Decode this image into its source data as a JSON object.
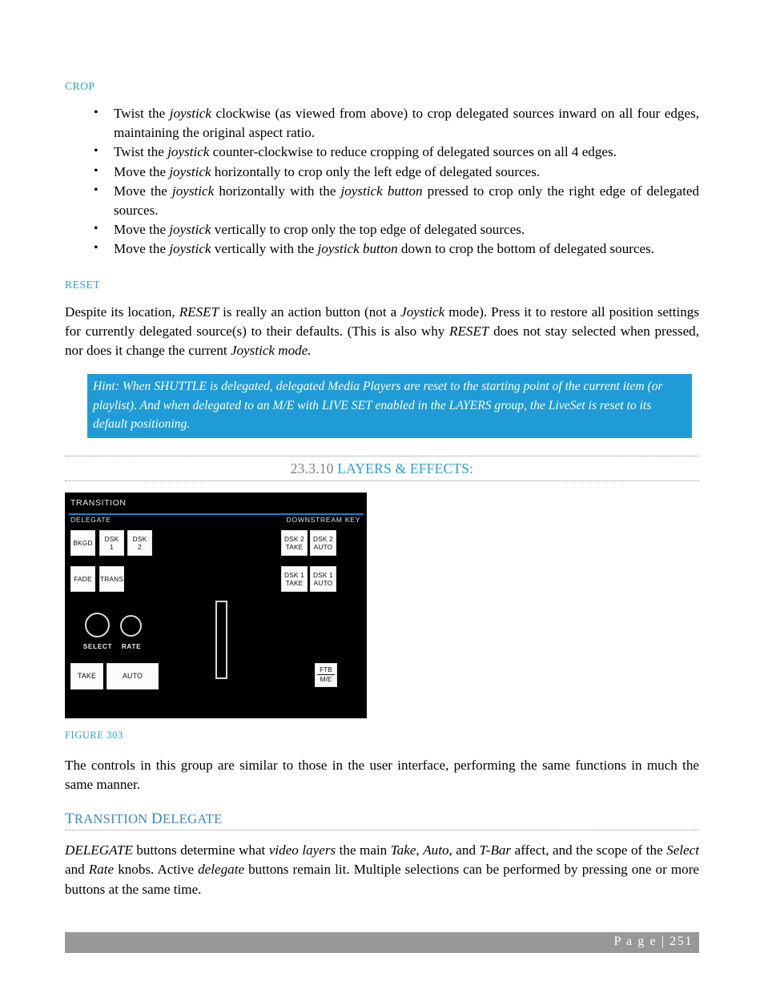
{
  "page": {
    "footer_label": "P a g e  | 251"
  },
  "crop_section": {
    "heading": "CROP",
    "bullets": [
      {
        "parts": [
          {
            "t": "Twist the ",
            "i": false
          },
          {
            "t": "joystick",
            "i": true
          },
          {
            "t": " clockwise (as viewed from above) to crop delegated sources inward on all four edges, maintaining the original aspect ratio.",
            "i": false
          }
        ]
      },
      {
        "parts": [
          {
            "t": "Twist the ",
            "i": false
          },
          {
            "t": "joystick",
            "i": true
          },
          {
            "t": " counter-clockwise to reduce cropping of delegated sources on all 4 edges.",
            "i": false
          }
        ]
      },
      {
        "parts": [
          {
            "t": "Move the ",
            "i": false
          },
          {
            "t": "joystick",
            "i": true
          },
          {
            "t": " horizontally to crop only the left edge of delegated sources.",
            "i": false
          }
        ]
      },
      {
        "parts": [
          {
            "t": "Move the ",
            "i": false
          },
          {
            "t": "joystick",
            "i": true
          },
          {
            "t": " horizontally with the ",
            "i": false
          },
          {
            "t": "joystick button",
            "i": true
          },
          {
            "t": " pressed to crop only the right edge of delegated sources.",
            "i": false
          }
        ]
      },
      {
        "parts": [
          {
            "t": "Move the ",
            "i": false
          },
          {
            "t": "joystick",
            "i": true
          },
          {
            "t": " vertically to crop only the top edge of delegated sources.",
            "i": false
          }
        ]
      },
      {
        "parts": [
          {
            "t": "Move the ",
            "i": false
          },
          {
            "t": "joystick",
            "i": true
          },
          {
            "t": " vertically with the ",
            "i": false
          },
          {
            "t": "joystick button",
            "i": true
          },
          {
            "t": " down to crop the bottom of delegated sources.",
            "i": false
          }
        ]
      }
    ]
  },
  "reset_section": {
    "heading": "RESET",
    "paragraph_parts": [
      {
        "t": "Despite its location, ",
        "i": false
      },
      {
        "t": "RESET",
        "i": true
      },
      {
        "t": " is really an action button (not a ",
        "i": false
      },
      {
        "t": "Joystick",
        "i": true
      },
      {
        "t": " mode).  Press it to restore all position settings for currently delegated source(s) to their defaults.  (This is also why ",
        "i": false
      },
      {
        "t": "RESET",
        "i": true
      },
      {
        "t": " does not stay selected when pressed, nor does it change the current ",
        "i": false
      },
      {
        "t": "Joystick mode.",
        "i": true
      }
    ],
    "hint": "Hint: When SHUTTLE is delegated, delegated Media Players are reset to the starting point of the current item (or playlist). And when delegated to an M/E with LIVE SET enabled in the LAYERS group, the LiveSet is reset to its default positioning."
  },
  "section_header": {
    "number": "23.3.10",
    "title": "LAYERS & EFFECTS:"
  },
  "figure": {
    "caption": "FIGURE 303",
    "panel": {
      "title": "TRANSITION",
      "delegate_label": "DELEGATE",
      "downstream_key_label": "DOWNSTREAM KEY",
      "delegate_buttons": [
        "BKGD",
        "DSK 1",
        "DSK 2",
        "FADE",
        "TRANS"
      ],
      "dsk_buttons": [
        "DSK 2 TAKE",
        "DSK 2 AUTO",
        "DSK 1 TAKE",
        "DSK 1 AUTO"
      ],
      "knobs": [
        "SELECT",
        "RATE"
      ],
      "action_buttons": [
        "TAKE",
        "AUTO"
      ],
      "ftb_top": "FTB",
      "ftb_bottom": "M/E",
      "colors": {
        "panel_bg": "#000000",
        "accent_line": "#1f7fd0",
        "button_face": "#fbfbfb",
        "tbar_outline": "#cfe0d4"
      }
    }
  },
  "body_paragraph": "The controls in this group are similar to those in the user interface, performing the same functions in much the same manner.",
  "transition_delegate": {
    "heading_first": "T",
    "heading_rest_1": "RANSITION",
    "heading_second": "D",
    "heading_rest_2": "ELEGATE",
    "paragraph_parts": [
      {
        "t": "DELEGATE",
        "i": true
      },
      {
        "t": " buttons determine what ",
        "i": false
      },
      {
        "t": "video layers",
        "i": true
      },
      {
        "t": " the main ",
        "i": false
      },
      {
        "t": "Take",
        "i": true
      },
      {
        "t": ", ",
        "i": false
      },
      {
        "t": "Auto",
        "i": true
      },
      {
        "t": ", and ",
        "i": false
      },
      {
        "t": "T-Bar",
        "i": true
      },
      {
        "t": " affect, and the scope of the ",
        "i": false
      },
      {
        "t": "Select",
        "i": true
      },
      {
        "t": " and ",
        "i": false
      },
      {
        "t": "Rate",
        "i": true
      },
      {
        "t": " knobs. Active ",
        "i": false
      },
      {
        "t": "delegate",
        "i": true
      },
      {
        "t": " buttons remain lit.  Multiple selections can be performed by pressing one or more buttons at the same time.",
        "i": false
      }
    ]
  },
  "theme": {
    "accent_blue": "#2a9fd6",
    "hint_blue": "#1f9cd8",
    "footer_gray": "#989898"
  }
}
